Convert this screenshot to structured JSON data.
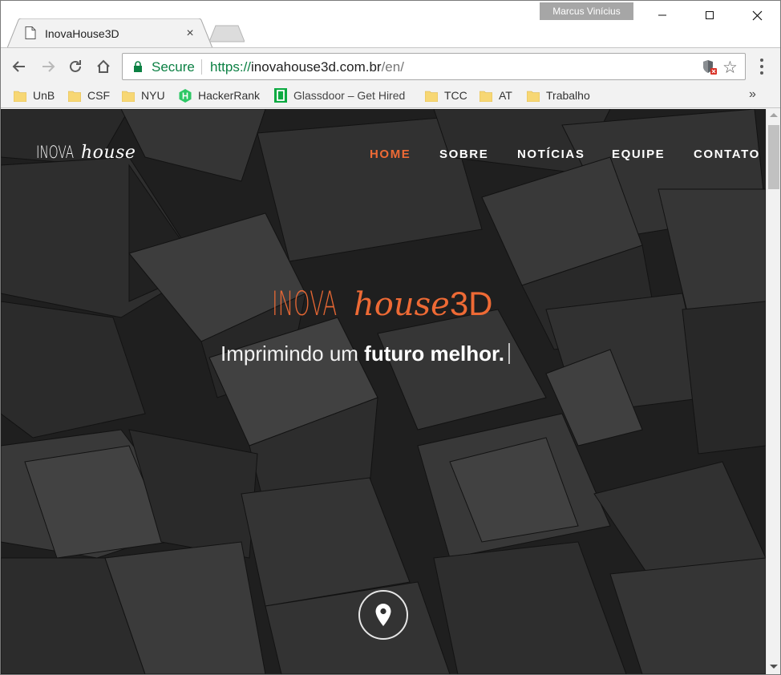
{
  "window": {
    "profile_name": "Marcus Vinícius"
  },
  "tab": {
    "title": "InovaHouse3D",
    "close_glyph": "×"
  },
  "address_bar": {
    "security_label": "Secure",
    "url_scheme": "https://",
    "url_host": "inovahouse3d.com.br",
    "url_path": "/en/"
  },
  "bookmarks": [
    {
      "label": "UnB",
      "icon": "folder-icon"
    },
    {
      "label": "CSF",
      "icon": "folder-icon"
    },
    {
      "label": "NYU",
      "icon": "folder-icon"
    },
    {
      "label": "HackerRank",
      "icon": "hackerrank-icon"
    },
    {
      "label": "Glassdoor – Get Hired",
      "icon": "glassdoor-icon"
    },
    {
      "label": "TCC",
      "icon": "folder-icon"
    },
    {
      "label": "AT",
      "icon": "folder-icon"
    },
    {
      "label": "Trabalho",
      "icon": "folder-icon"
    }
  ],
  "bookmarks_more": "»",
  "site": {
    "logo_inova": "INOVA",
    "logo_house": "house",
    "nav": [
      "HOME",
      "SOBRE",
      "NOTÍCIAS",
      "EQUIPE",
      "CONTATO"
    ],
    "active_nav": "HOME",
    "hero_inova": "INOVA",
    "hero_house": "house",
    "hero_3d": "3D",
    "tagline_prefix": "Imprimindo um ",
    "tagline_bold": "futuro melhor."
  },
  "colors": {
    "accent": "#ee6a35",
    "secure_green": "#0b8043",
    "hero_bg": "#2a2a2a"
  }
}
